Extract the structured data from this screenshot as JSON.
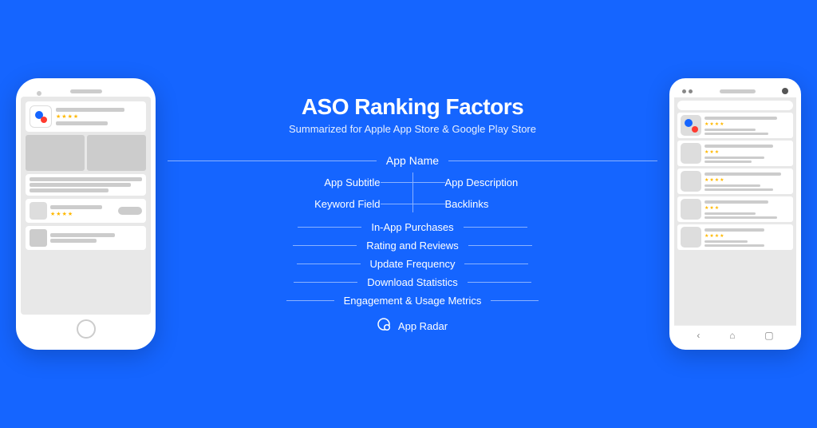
{
  "header": {
    "title": "ASO Ranking Factors",
    "subtitle": "Summarized for Apple App Store & Google Play Store"
  },
  "factors": {
    "app_name": "App Name",
    "app_subtitle": "App Subtitle",
    "keyword_field": "Keyword Field",
    "app_description": "App Description",
    "backlinks": "Backlinks",
    "in_app_purchases": "In-App Purchases",
    "rating_reviews": "Rating and Reviews",
    "update_frequency": "Update Frequency",
    "download_statistics": "Download Statistics",
    "engagement_metrics": "Engagement & Usage Metrics"
  },
  "brand": {
    "name": "App Radar"
  },
  "nav_icons": {
    "back": "‹",
    "home": "⌂",
    "recent": "▢"
  }
}
